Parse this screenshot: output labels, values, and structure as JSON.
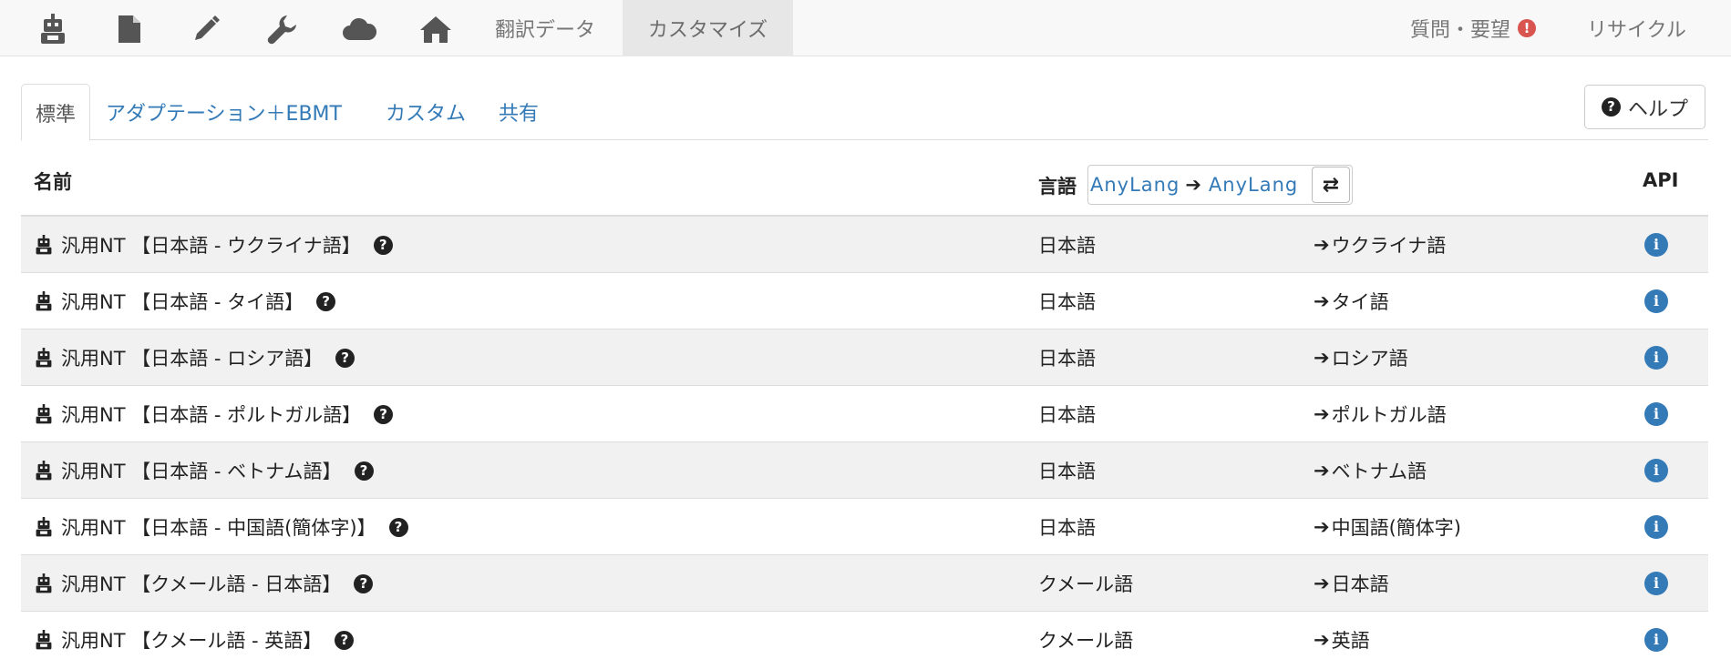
{
  "navbar": {
    "icons": [
      "robot-icon",
      "file-icon",
      "pencil-icon",
      "wrench-icon",
      "cloud-icon",
      "home-icon"
    ],
    "links": {
      "translation_data": "翻訳データ",
      "customize": "カスタマイズ",
      "questions": "質問・要望",
      "questions_badge": "!",
      "recycle": "リサイクル"
    }
  },
  "tabs": {
    "standard": "標準",
    "adaptation": "アダプテーション＋EBMT",
    "custom": "カスタム",
    "shared": "共有",
    "help": "ヘルプ"
  },
  "table": {
    "headers": {
      "name": "名前",
      "language": "言語",
      "api": "API"
    },
    "lang_filter": {
      "source": "AnyLang",
      "arrow": "➔",
      "target": "AnyLang"
    },
    "arrow": "➔",
    "rows": [
      {
        "name": "汎用NT 【日本語 - ウクライナ語】",
        "source": "日本語",
        "target": "ウクライナ語"
      },
      {
        "name": "汎用NT 【日本語 - タイ語】",
        "source": "日本語",
        "target": "タイ語"
      },
      {
        "name": "汎用NT 【日本語 - ロシア語】",
        "source": "日本語",
        "target": "ロシア語"
      },
      {
        "name": "汎用NT 【日本語 - ポルトガル語】",
        "source": "日本語",
        "target": "ポルトガル語"
      },
      {
        "name": "汎用NT 【日本語 - ベトナム語】",
        "source": "日本語",
        "target": "ベトナム語"
      },
      {
        "name": "汎用NT 【日本語 - 中国語(簡体字)】",
        "source": "日本語",
        "target": "中国語(簡体字)"
      },
      {
        "name": "汎用NT 【クメール語 - 日本語】",
        "source": "クメール語",
        "target": "日本語"
      },
      {
        "name": "汎用NT 【クメール語 - 英語】",
        "source": "クメール語",
        "target": "英語"
      }
    ]
  },
  "colors": {
    "link": "#337ab7",
    "alert": "#d9534f",
    "row_stripe": "#f1f1f1"
  }
}
